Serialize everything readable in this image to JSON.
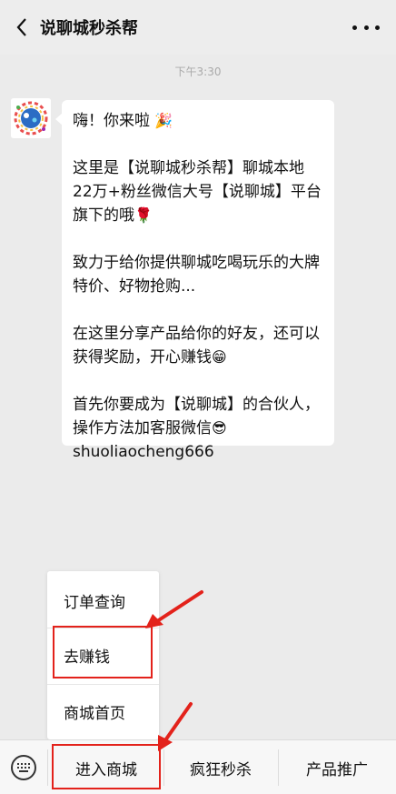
{
  "header": {
    "back_icon": "chevron-left-icon",
    "title": "说聊城秒杀帮",
    "more_icon": "more-dots-icon"
  },
  "timestamp": "下午3:30",
  "message": {
    "avatar_icon": "official-account-avatar",
    "line1": "嗨！你来啦",
    "line1_emoji": "🎉",
    "para2": "这里是【说聊城秒杀帮】聊城本地22万+粉丝微信大号【说聊城】平台旗下的哦",
    "para2_emoji": "🌹",
    "para3": "致力于给你提供聊城吃喝玩乐的大牌特价、好物抢购...",
    "para4": "在这里分享产品给你的好友，还可以获得奖励，开心赚钱",
    "para4_emoji": "😁",
    "para5": "首先你要成为【说聊城】的合伙人，操作方法加客服微信",
    "para5_emoji": "😎",
    "para5_id": "shuoliaocheng666"
  },
  "popup_menu": {
    "items": [
      {
        "label": "订单查询"
      },
      {
        "label": "去赚钱"
      },
      {
        "label": "商城首页"
      }
    ]
  },
  "bottom_bar": {
    "keyboard_icon": "keyboard-icon",
    "tabs": [
      {
        "label": "进入商城"
      },
      {
        "label": "疯狂秒杀"
      },
      {
        "label": "产品推广"
      }
    ]
  },
  "annotation_color": "#e3221b"
}
